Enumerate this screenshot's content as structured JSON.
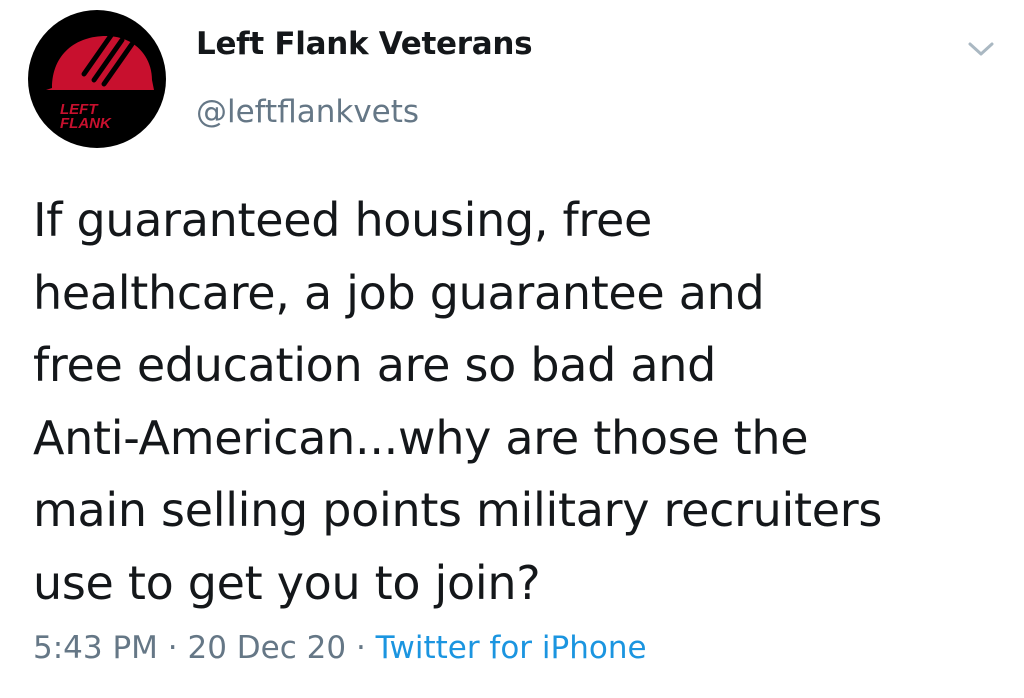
{
  "account": {
    "display_name": "Left Flank Veterans",
    "handle": "@leftflankvets",
    "avatar_logo_text": "LEFT FLANK"
  },
  "tweet": {
    "text": "If guaranteed housing, free\nhealthcare, a job guarantee and\nfree education are so bad and\nAnti-American...why are those the\nmain selling points military recruiters\nuse to get you to join?"
  },
  "meta": {
    "time": "5:43 PM",
    "separator": "·",
    "date": "20 Dec 20",
    "source": "Twitter for iPhone"
  },
  "icons": {
    "menu": "chevron-down-icon"
  },
  "colors": {
    "text": "#14171a",
    "secondary": "#657786",
    "link": "#1b95e0",
    "avatar_bg": "#000000",
    "avatar_red": "#c8102e"
  }
}
